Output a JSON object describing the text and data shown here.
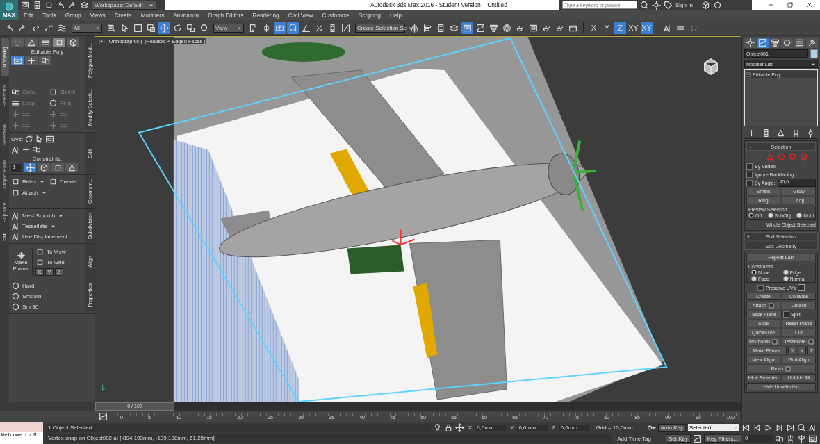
{
  "title_bar": {
    "app_menu_label": "MAX",
    "workspace": "Workspace: Default",
    "title": "Autodesk 3ds Max 2016 - Student Version    Untitled",
    "search_placeholder": "Type a keyword or phrase",
    "sign_in": "Sign In"
  },
  "menu": [
    "Edit",
    "Tools",
    "Group",
    "Views",
    "Create",
    "Modifiers",
    "Animation",
    "Graph Editors",
    "Rendering",
    "Civil View",
    "Customize",
    "Scripting",
    "Help"
  ],
  "main_toolbar": {
    "selection_filter": "All",
    "reference_coordinate": "View",
    "named_selection": "Create Selection Se",
    "tools": [
      {
        "selected": false
      },
      {
        "selected": false
      },
      {
        "selected": false
      },
      {
        "selected": false
      },
      {
        "selected": false
      },
      {
        "selected": false
      },
      {
        "selected": false
      },
      {
        "selected": false
      },
      {
        "selected": false
      },
      {
        "selected": true
      },
      {
        "selected": false
      },
      {
        "selected": false
      },
      {
        "selected": false
      },
      {
        "selected": false
      },
      {
        "selected": false
      },
      {
        "selected": true
      },
      {
        "selected": true
      },
      {
        "selected": false
      },
      {
        "selected": false
      },
      {
        "selected": false
      },
      {
        "selected": false
      },
      {
        "selected": false
      },
      {
        "selected": false
      },
      {
        "selected": false
      },
      {
        "selected": false
      },
      {
        "selected": true
      },
      {
        "selected": false
      },
      {
        "selected": false
      },
      {
        "selected": false
      },
      {
        "selected": false
      },
      {
        "selected": false
      },
      {
        "selected": false
      },
      {
        "selected": false
      },
      {
        "selected": false
      },
      {
        "selected": false
      },
      {
        "selected": false
      },
      {
        "selected": false
      }
    ],
    "axis_constraints": [
      {
        "label": "X",
        "selected": false
      },
      {
        "label": "Y",
        "selected": false
      },
      {
        "label": "Z",
        "selected": true
      },
      {
        "label": "XY",
        "selected": false
      },
      {
        "label": "XY",
        "selected": true
      }
    ]
  },
  "ribbon": {
    "tabs": [
      {
        "label": "Modeling",
        "selected": true
      },
      {
        "label": "Freeform",
        "selected": false
      },
      {
        "label": "Selection",
        "selected": false
      },
      {
        "label": "Object Paint",
        "selected": false
      },
      {
        "label": "Populate",
        "selected": false
      }
    ],
    "polygon_modeling": {
      "title": "Polygon Mod...",
      "label": "Editable Poly",
      "levels": [
        {
          "selected": false
        },
        {
          "selected": false
        },
        {
          "selected": false
        },
        {
          "selected": true
        },
        {
          "selected": false
        }
      ],
      "modes": [
        {
          "selected": true
        },
        {
          "selected": false
        },
        {
          "selected": false
        }
      ]
    },
    "modify_selection": {
      "title": "Modify Selecti...",
      "buttons": [
        {
          "label": "Grow",
          "disabled": true
        },
        {
          "label": "Shrink",
          "disabled": true
        },
        {
          "label": "Loop",
          "disabled": true
        },
        {
          "label": "Ring",
          "disabled": true
        }
      ]
    },
    "edit": {
      "title": "Edit",
      "uvs_label": "UVs:",
      "constraints_label": "Constraints:",
      "constraints": [
        {
          "selected": true
        },
        {
          "selected": false
        },
        {
          "selected": false
        },
        {
          "selected": false
        }
      ],
      "spinner_value": "1"
    },
    "geometry": {
      "title": "Geometr...",
      "buttons": [
        {
          "label": "Relax",
          "dropdown": true
        },
        {
          "label": "Create",
          "dropdown": false
        },
        {
          "label": "Attach",
          "dropdown": true
        }
      ]
    },
    "subdivision": {
      "title": "Subdivision",
      "buttons": [
        {
          "label": "MeshSmooth",
          "dropdown": true
        },
        {
          "label": "Tessellate",
          "dropdown": true
        },
        {
          "label": "Use Displacement",
          "dropdown": false
        }
      ]
    },
    "align": {
      "title": "Align",
      "make_planar": "Make Planar",
      "buttons": [
        "To View",
        "To Grid"
      ],
      "axes": [
        "X",
        "Y",
        "Z"
      ]
    },
    "properties": {
      "title": "Properties",
      "buttons": [
        "Hard",
        "Smooth",
        "Sm 30"
      ]
    }
  },
  "viewport": {
    "labels": [
      "[+]",
      "[Orthographic ]",
      "[Realistic + Edged Faces ]"
    ]
  },
  "command_panel": {
    "tabs": [
      {
        "selected": false
      },
      {
        "selected": true
      },
      {
        "selected": false
      },
      {
        "selected": false
      },
      {
        "selected": false
      },
      {
        "selected": false
      }
    ],
    "object_name": "Object001",
    "modifier_list": "Modifier List",
    "stack": [
      "Editable Poly"
    ],
    "selection": {
      "title": "Selection",
      "toggle": "-",
      "checkboxes": [
        {
          "label": "By Vertex",
          "checked": false
        },
        {
          "label": "Ignore Backfacing",
          "checked": false
        },
        {
          "label": "By Angle:",
          "checked": false
        }
      ],
      "angle": "45,0",
      "buttons": [
        "Shrink",
        "Grow",
        "Ring",
        "Loop"
      ],
      "preview": {
        "title": "Preview Selection",
        "options": [
          {
            "label": "Off",
            "selected": true
          },
          {
            "label": "SubObj",
            "selected": false
          },
          {
            "label": "Multi",
            "selected": false
          }
        ]
      },
      "status": "Whole Object Selected"
    },
    "soft_selection": {
      "title": "Soft Selection",
      "toggle": "+"
    },
    "edit_geometry": {
      "title": "Edit Geometry",
      "toggle": "-",
      "repeat_last": "Repeat Last",
      "constraints": {
        "title": "Constraints",
        "options": [
          {
            "label": "None",
            "selected": true
          },
          {
            "label": "Edge",
            "selected": false
          },
          {
            "label": "Face",
            "selected": false
          },
          {
            "label": "Normal",
            "selected": false
          }
        ]
      },
      "preserve_uvs": {
        "label": "Preserve UVs",
        "checked": false
      },
      "rows": [
        [
          {
            "kind": "button",
            "label": "Create",
            "settings": false
          },
          {
            "kind": "button",
            "label": "Collapse",
            "settings": false
          }
        ],
        [
          {
            "kind": "button",
            "label": "Attach",
            "settings": true
          },
          {
            "kind": "button",
            "label": "Detach",
            "settings": false
          }
        ],
        [
          {
            "kind": "button",
            "label": "Slice Plane",
            "settings": false
          },
          {
            "kind": "checkbox",
            "label": "Split",
            "checked": false
          }
        ],
        [
          {
            "kind": "button",
            "label": "Slice",
            "settings": false
          },
          {
            "kind": "button",
            "label": "Reset Plane",
            "settings": false
          }
        ],
        [
          {
            "kind": "button",
            "label": "QuickSlice",
            "settings": false
          },
          {
            "kind": "button",
            "label": "Cut",
            "settings": false
          }
        ],
        [
          {
            "kind": "button",
            "label": "MSmooth",
            "settings": true
          },
          {
            "kind": "button",
            "label": "Tessellate",
            "settings": true
          }
        ],
        [
          {
            "kind": "button",
            "label": "Make Planar",
            "settings": false
          },
          {
            "kind": "button",
            "label": "X",
            "settings": false
          },
          {
            "kind": "button",
            "label": "Y",
            "settings": false
          },
          {
            "kind": "button",
            "label": "Z",
            "settings": false
          }
        ],
        [
          {
            "kind": "button",
            "label": "View Align",
            "settings": false
          },
          {
            "kind": "button",
            "label": "Grid Align",
            "settings": false
          }
        ],
        [
          {
            "kind": "button",
            "label": "Relax",
            "settings": true
          }
        ],
        [
          {
            "kind": "button",
            "label": "Hide Selected",
            "settings": false
          },
          {
            "kind": "button",
            "label": "Unhide All",
            "settings": false
          }
        ],
        [
          {
            "kind": "button",
            "label": "Hide Unselected",
            "settings": false
          }
        ]
      ]
    }
  },
  "timeline": {
    "position": "0 / 100",
    "level": 0,
    "ruler_labels": [
      "0",
      "5",
      "10",
      "15",
      "20",
      "25",
      "30",
      "35",
      "40",
      "45",
      "50",
      "55",
      "60",
      "65",
      "70",
      "75",
      "80",
      "85",
      "90",
      "95",
      "100"
    ]
  },
  "status": {
    "listener": "Welcome to M",
    "selection_info": "1 Object Selected",
    "prompt": "Vertex snap on Object002 at [-894,193mm, -139,188mm, 61,25mm]",
    "coords": [
      {
        "axis": "X:",
        "value": "0,0mm"
      },
      {
        "axis": "Y:",
        "value": "0,0mm"
      },
      {
        "axis": "Z:",
        "value": "0,0mm"
      }
    ],
    "grid": "Grid = 10,0mm",
    "add_time_tag": "Add Time Tag",
    "auto_key": "Auto Key",
    "key_set": "Selected",
    "set_key": "Set Key",
    "key_filters": "Key Filters...",
    "frame": "0"
  }
}
